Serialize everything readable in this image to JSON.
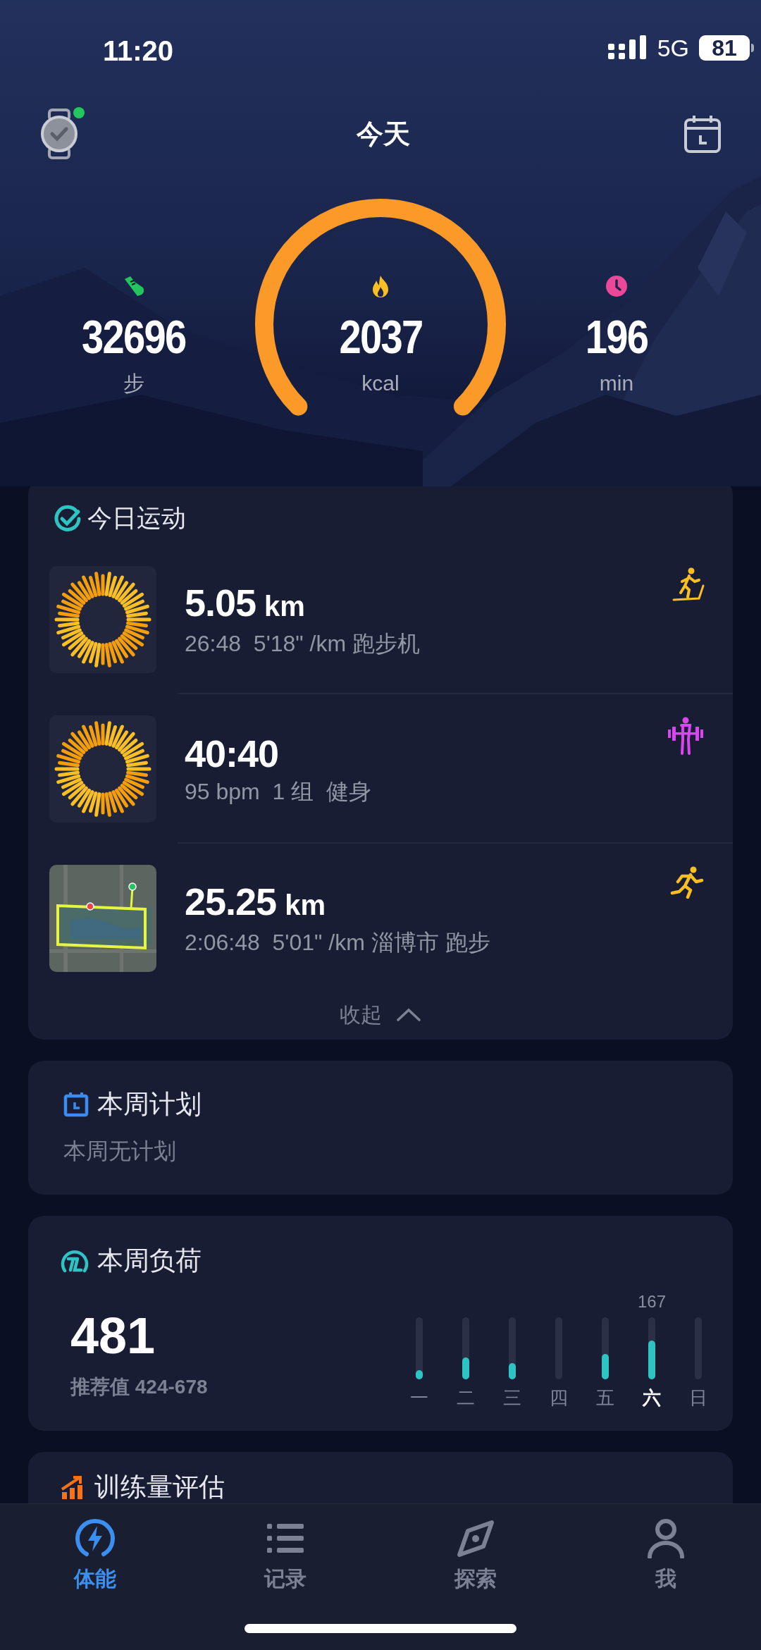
{
  "status_bar": {
    "time": "11:20",
    "network": "5G",
    "battery": "81"
  },
  "header": {
    "title": "今天",
    "watch_connected": true
  },
  "metrics": [
    {
      "kind": "steps",
      "value": "32696",
      "unit": "步"
    },
    {
      "kind": "calories",
      "value": "2037",
      "unit": "kcal"
    },
    {
      "kind": "time",
      "value": "196",
      "unit": "min"
    }
  ],
  "today_workouts": {
    "title": "今日运动",
    "items": [
      {
        "kind": "treadmill",
        "thumb": {
          "kind": "rings"
        },
        "value": "5.05",
        "unit": "km",
        "detail": "26:48  5'18\" /km 跑步机"
      },
      {
        "kind": "strength",
        "thumb": {
          "kind": "rings"
        },
        "value": "40:40",
        "detail": "95 bpm  1 组  健身"
      },
      {
        "kind": "run",
        "value": "25.25",
        "unit": "km",
        "detail": "2:06:48  5'01\" /km 淄博市 跑步"
      }
    ],
    "collapse": "收起"
  },
  "weekly_plan": {
    "title": "本周计划",
    "subtitle": "本周无计划"
  },
  "weekly_load": {
    "title": "本周负荷",
    "value": "481",
    "recommended": "推荐值 424-678",
    "days": [
      {
        "label": "一",
        "level": 0.15,
        "selected": false
      },
      {
        "label": "二",
        "level": 0.35,
        "selected": false
      },
      {
        "label": "三",
        "level": 0.26,
        "selected": false
      },
      {
        "label": "四",
        "selected": false
      },
      {
        "label": "五",
        "level": 0.41,
        "selected": false
      },
      {
        "label": "六",
        "level": 0.63,
        "selected": true,
        "value": "167"
      },
      {
        "label": "日",
        "selected": false
      }
    ]
  },
  "training_assessment": {
    "title": "训练量评估"
  },
  "tab_bar": [
    {
      "kind": "energy",
      "label": "体能",
      "selected": true
    },
    {
      "kind": "list",
      "label": "记录",
      "selected": false
    },
    {
      "kind": "compass",
      "label": "探索",
      "selected": false
    },
    {
      "kind": "person",
      "label": "我",
      "selected": false
    }
  ]
}
